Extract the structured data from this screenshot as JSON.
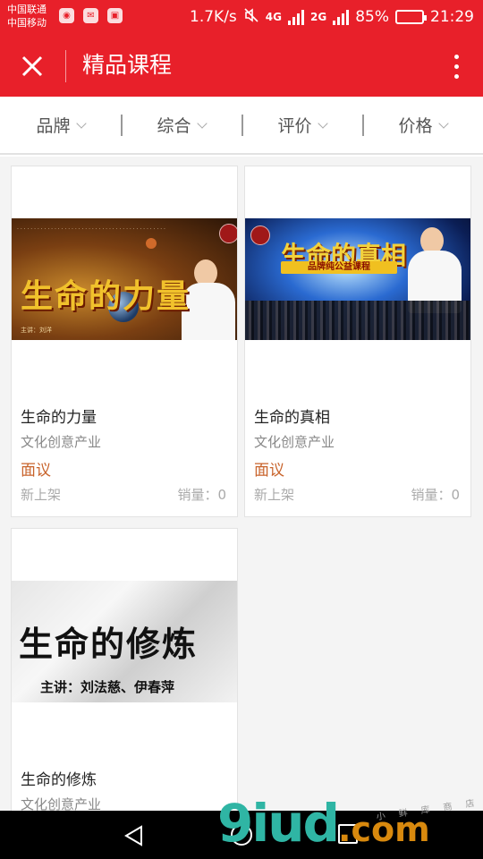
{
  "status_bar": {
    "carrier1": "中国联通",
    "carrier2": "中国移动",
    "speed": "1.7K/s",
    "network1": "4G",
    "network2": "2G",
    "battery": "85%",
    "battery_level": 0.85,
    "time": "21:29"
  },
  "header": {
    "title": "精品课程"
  },
  "filters": [
    {
      "label": "品牌"
    },
    {
      "label": "综合"
    },
    {
      "label": "评价"
    },
    {
      "label": "价格"
    }
  ],
  "products": [
    {
      "title": "生命的力量",
      "category": "文化创意产业",
      "price": "面议",
      "status": "新上架",
      "sales": "销量：0",
      "banner_title": "生命的力量",
      "banner_caption": "主讲：刘洋"
    },
    {
      "title": "生命的真相",
      "category": "文化创意产业",
      "price": "面议",
      "status": "新上架",
      "sales": "销量：0",
      "banner_title": "生命的真相",
      "banner_subtitle": "品牌纯公益课程"
    },
    {
      "title": "生命的修炼",
      "category": "文化创意产业",
      "banner_title": "生命的修炼",
      "banner_subtitle": "主讲：刘法慈、伊春萍"
    }
  ],
  "watermark": {
    "main": "9iud",
    "suffix": ".com",
    "small": "小 鲜 库 商 店"
  },
  "colors": {
    "brand_red": "#e8202a",
    "price_orange": "#c8632b"
  }
}
